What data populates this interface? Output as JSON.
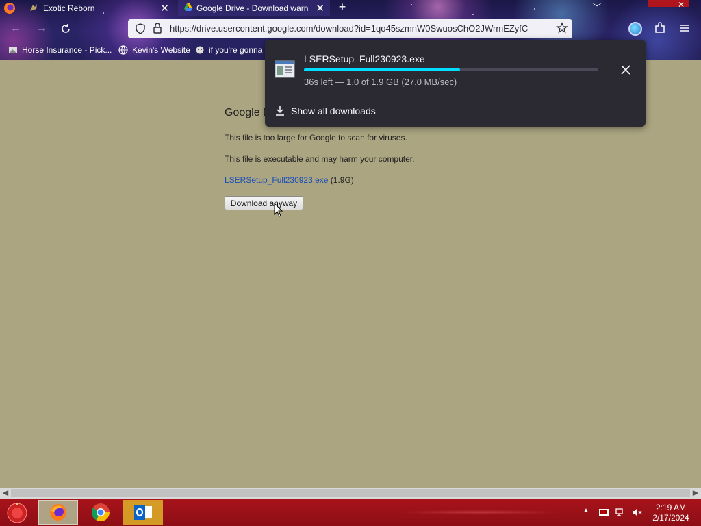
{
  "browser": {
    "tabs": [
      {
        "title": "Exotic Reborn",
        "active": false
      },
      {
        "title": "Google Drive - Download warn",
        "active": true
      }
    ],
    "url": "https://drive.usercontent.google.com/download?id=1qo45szmnW0SwuosChO2JWrmEZyfC",
    "bookmarks": [
      {
        "label": "Horse Insurance - Pick..."
      },
      {
        "label": "Kevin's Website"
      },
      {
        "label": "if you're gonna"
      }
    ]
  },
  "page": {
    "heading": "Google D",
    "line1": "This file is too large for Google to scan for viruses.",
    "line2": "This file is executable and may harm your computer.",
    "file_link": "LSERSetup_Full230923.exe",
    "file_size": " (1.9G)",
    "download_button": "Download anyway"
  },
  "download_panel": {
    "filename": "LSERSetup_Full230923.exe",
    "progress_fraction": 0.53,
    "status": "36s left — 1.0 of 1.9 GB (27.0 MB/sec)",
    "show_all_label": "Show all downloads",
    "accent_color": "#00ddff"
  },
  "taskbar": {
    "apps": [
      "firefox",
      "chrome",
      "outlook"
    ],
    "time": "2:19 AM",
    "date": "2/17/2024"
  }
}
